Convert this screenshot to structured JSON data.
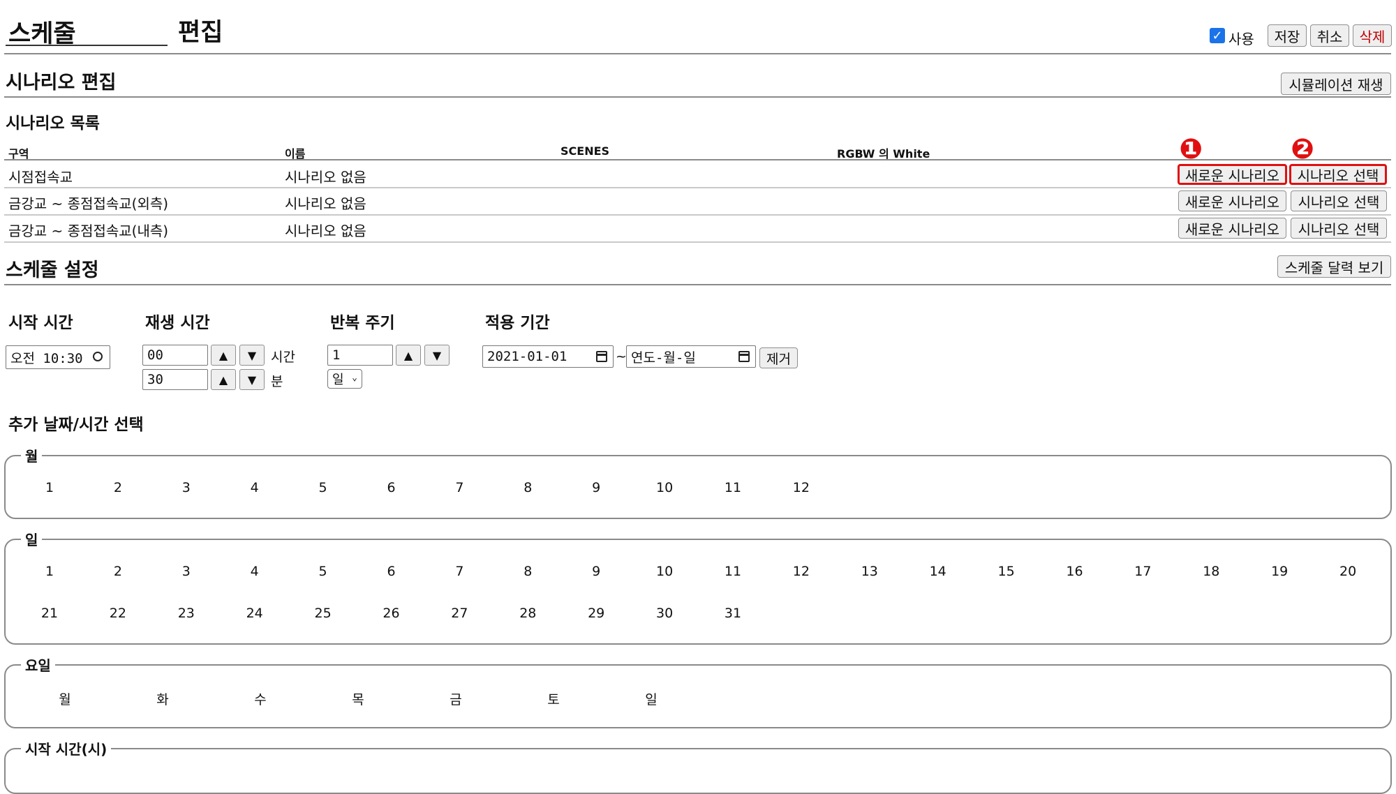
{
  "header": {
    "title_input": "스케줄",
    "title_suffix": "편집",
    "use_label": "사용",
    "save": "저장",
    "cancel": "취소",
    "delete": "삭제"
  },
  "scenario_edit": {
    "title": "시나리오 편집",
    "simulation_button": "시뮬레이션 재생",
    "list_title": "시나리오 목록",
    "columns": [
      "구역",
      "이름",
      "SCENES",
      "RGBW 의 White"
    ],
    "rows": [
      {
        "zone": "시점접속교",
        "name": "시나리오 없음"
      },
      {
        "zone": "금강교 ~ 종점접속교(외측)",
        "name": "시나리오 없음"
      },
      {
        "zone": "금강교 ~ 종점접속교(내측)",
        "name": "시나리오 없음"
      }
    ],
    "new_scenario": "새로운 시나리오",
    "select_scenario": "시나리오 선택",
    "markers": [
      "❶",
      "❷"
    ]
  },
  "schedule": {
    "title": "스케줄 설정",
    "calendar_button": "스케줄 달력 보기",
    "start_time_label": "시작 시간",
    "start_time_value": "오전 10:30",
    "play_time_label": "재생 시간",
    "hours_value": "00",
    "hours_unit": "시간",
    "minutes_value": "30",
    "minutes_unit": "분",
    "repeat_label": "반복 주기",
    "repeat_value": "1",
    "repeat_unit": "일",
    "period_label": "적용 기간",
    "period_start": "2021-01-01",
    "period_sep": "~",
    "period_end_placeholder": "연도-월-일",
    "remove": "제거",
    "up": "▲",
    "down": "▼"
  },
  "extra": {
    "title": "추가 날짜/시간 선택",
    "month_legend": "월",
    "months": [
      "1",
      "2",
      "3",
      "4",
      "5",
      "6",
      "7",
      "8",
      "9",
      "10",
      "11",
      "12"
    ],
    "day_legend": "일",
    "days_row1": [
      "1",
      "2",
      "3",
      "4",
      "5",
      "6",
      "7",
      "8",
      "9",
      "10",
      "11",
      "12",
      "13",
      "14",
      "15",
      "16",
      "17",
      "18",
      "19",
      "20"
    ],
    "days_row2": [
      "21",
      "22",
      "23",
      "24",
      "25",
      "26",
      "27",
      "28",
      "29",
      "30",
      "31"
    ],
    "weekday_legend": "요일",
    "weekdays": [
      "월",
      "화",
      "수",
      "목",
      "금",
      "토",
      "일"
    ],
    "start_hour_legend": "시작 시간(시)"
  }
}
